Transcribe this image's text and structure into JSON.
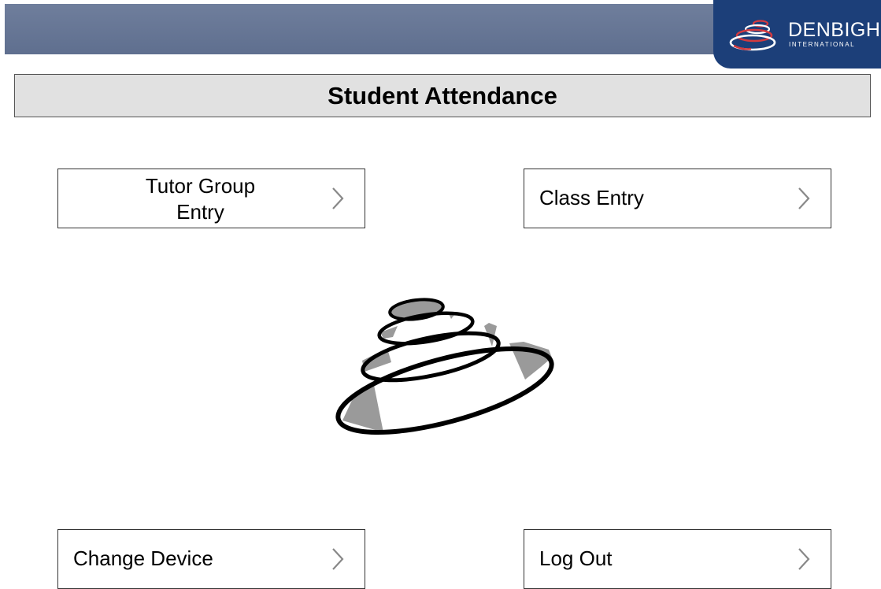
{
  "header": {
    "brand_name": "DENBIGH",
    "brand_sub": "INTERNATIONAL",
    "icon": "denbigh-logo-icon",
    "band_color": "#65759a",
    "badge_color": "#1c3f79"
  },
  "page": {
    "title": "Student Attendance"
  },
  "buttons": {
    "tutor_group": {
      "label_line1": "Tutor Group",
      "label_line2": "Entry"
    },
    "class_entry": {
      "label": "Class Entry"
    },
    "change_device": {
      "label": "Change Device"
    },
    "log_out": {
      "label": "Log Out"
    },
    "chevron_icon": "chevron-right-icon"
  },
  "center": {
    "icon": "denbigh-logo-icon"
  }
}
